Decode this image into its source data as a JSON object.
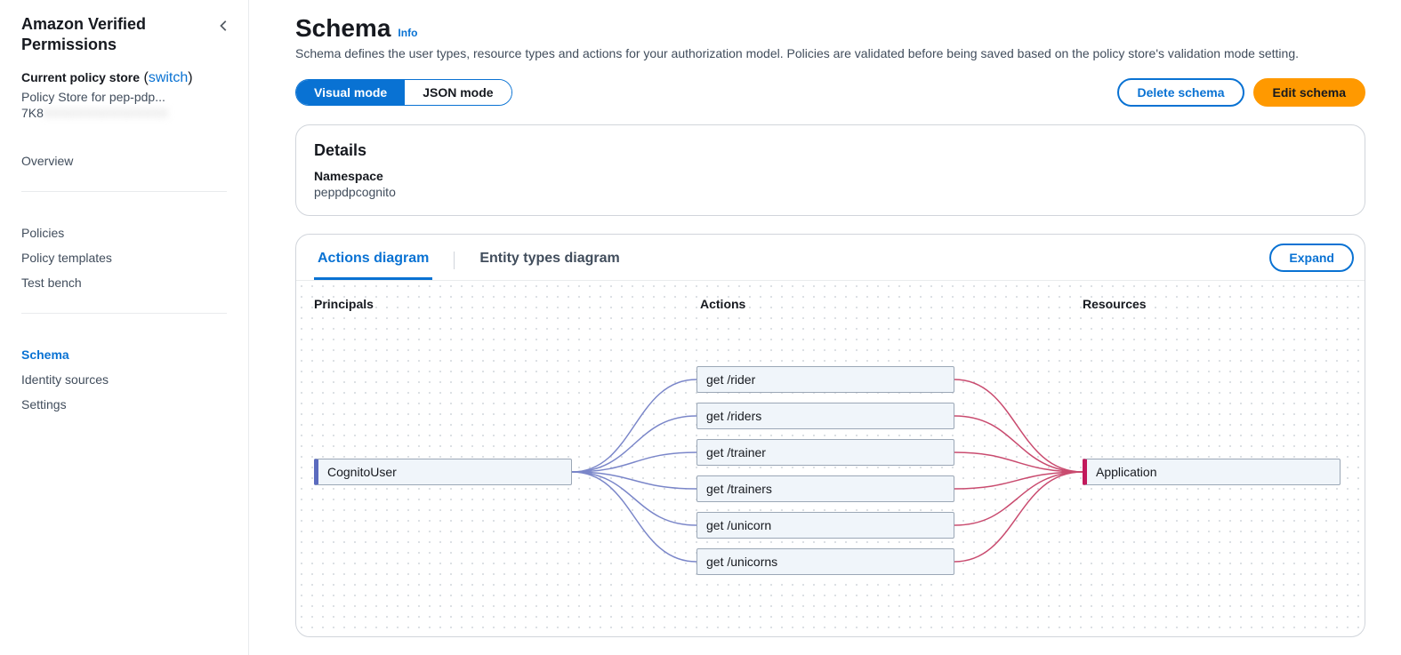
{
  "sidebar": {
    "title": "Amazon Verified Permissions",
    "storeLabel": "Current policy store",
    "switch": "switch",
    "storeName": "Policy Store for pep-pdp...",
    "storeIdPrefix": "7K8",
    "nav": {
      "overview": "Overview",
      "policies": "Policies",
      "templates": "Policy templates",
      "testbench": "Test bench",
      "schema": "Schema",
      "identity": "Identity sources",
      "settings": "Settings"
    }
  },
  "page": {
    "title": "Schema",
    "info": "Info",
    "desc": "Schema defines the user types, resource types and actions for your authorization model. Policies are validated before being saved based on the policy store's validation mode setting."
  },
  "modes": {
    "visual": "Visual mode",
    "json": "JSON mode"
  },
  "buttons": {
    "delete": "Delete schema",
    "edit": "Edit schema",
    "expand": "Expand"
  },
  "details": {
    "heading": "Details",
    "namespaceLabel": "Namespace",
    "namespaceValue": "peppdpcognito"
  },
  "tabs": {
    "actions": "Actions diagram",
    "entity": "Entity types diagram"
  },
  "diagram": {
    "col1": "Principals",
    "col2": "Actions",
    "col3": "Resources",
    "principal": "CognitoUser",
    "resource": "Application",
    "actions": [
      "get /rider",
      "get /riders",
      "get /trainer",
      "get /trainers",
      "get /unicorn",
      "get /unicorns"
    ]
  }
}
